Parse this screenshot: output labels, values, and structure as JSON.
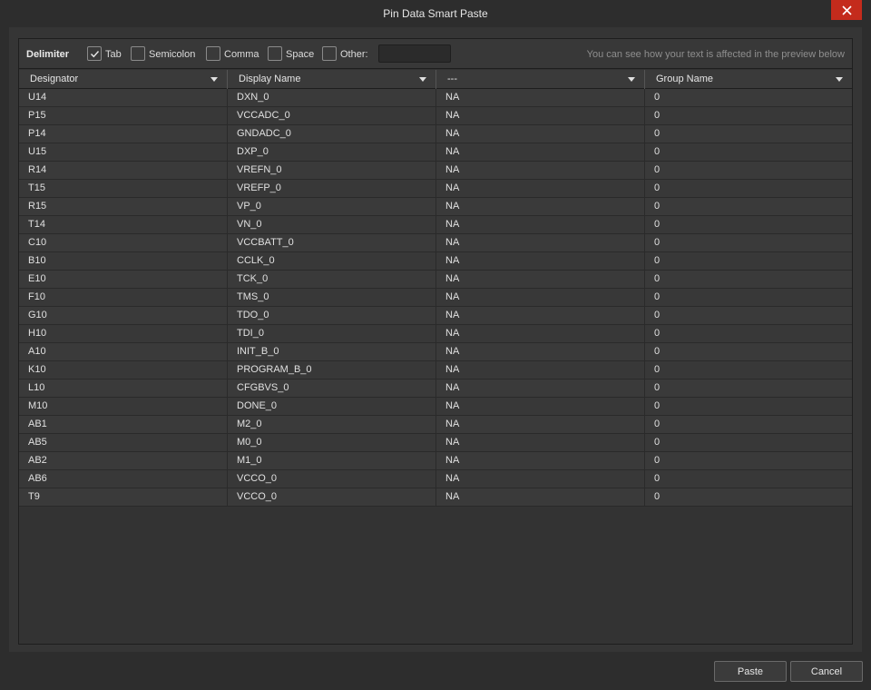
{
  "window": {
    "title": "Pin Data Smart Paste"
  },
  "delimiter": {
    "label": "Delimiter",
    "options": [
      {
        "label": "Tab",
        "checked": true
      },
      {
        "label": "Semicolon",
        "checked": false
      },
      {
        "label": "Comma",
        "checked": false
      },
      {
        "label": "Space",
        "checked": false
      },
      {
        "label": "Other:",
        "checked": false
      }
    ],
    "other_value": "",
    "hint": "You can see how your text is affected in the preview below"
  },
  "grid": {
    "columns": [
      "Designator",
      "Display Name",
      "---",
      "Group Name"
    ],
    "rows": [
      [
        "U14",
        "DXN_0",
        "NA",
        "0"
      ],
      [
        "P15",
        "VCCADC_0",
        "NA",
        "0"
      ],
      [
        "P14",
        "GNDADC_0",
        "NA",
        "0"
      ],
      [
        "U15",
        "DXP_0",
        "NA",
        "0"
      ],
      [
        "R14",
        "VREFN_0",
        "NA",
        "0"
      ],
      [
        "T15",
        "VREFP_0",
        "NA",
        "0"
      ],
      [
        "R15",
        "VP_0",
        "NA",
        "0"
      ],
      [
        "T14",
        "VN_0",
        "NA",
        "0"
      ],
      [
        "C10",
        "VCCBATT_0",
        "NA",
        "0"
      ],
      [
        "B10",
        "CCLK_0",
        "NA",
        "0"
      ],
      [
        "E10",
        "TCK_0",
        "NA",
        "0"
      ],
      [
        "F10",
        "TMS_0",
        "NA",
        "0"
      ],
      [
        "G10",
        "TDO_0",
        "NA",
        "0"
      ],
      [
        "H10",
        "TDI_0",
        "NA",
        "0"
      ],
      [
        "A10",
        "INIT_B_0",
        "NA",
        "0"
      ],
      [
        "K10",
        "PROGRAM_B_0",
        "NA",
        "0"
      ],
      [
        "L10",
        "CFGBVS_0",
        "NA",
        "0"
      ],
      [
        "M10",
        "DONE_0",
        "NA",
        "0"
      ],
      [
        "AB1",
        "M2_0",
        "NA",
        "0"
      ],
      [
        "AB5",
        "M0_0",
        "NA",
        "0"
      ],
      [
        "AB2",
        "M1_0",
        "NA",
        "0"
      ],
      [
        "AB6",
        "VCCO_0",
        "NA",
        "0"
      ],
      [
        "T9",
        "VCCO_0",
        "NA",
        "0"
      ]
    ]
  },
  "buttons": {
    "paste": "Paste",
    "cancel": "Cancel"
  },
  "colors": {
    "close": "#c42b1c",
    "background": "#2d2d2d"
  },
  "icons": {
    "close": "close-icon",
    "check": "checkmark-icon",
    "dropdown": "chevron-down-icon"
  }
}
